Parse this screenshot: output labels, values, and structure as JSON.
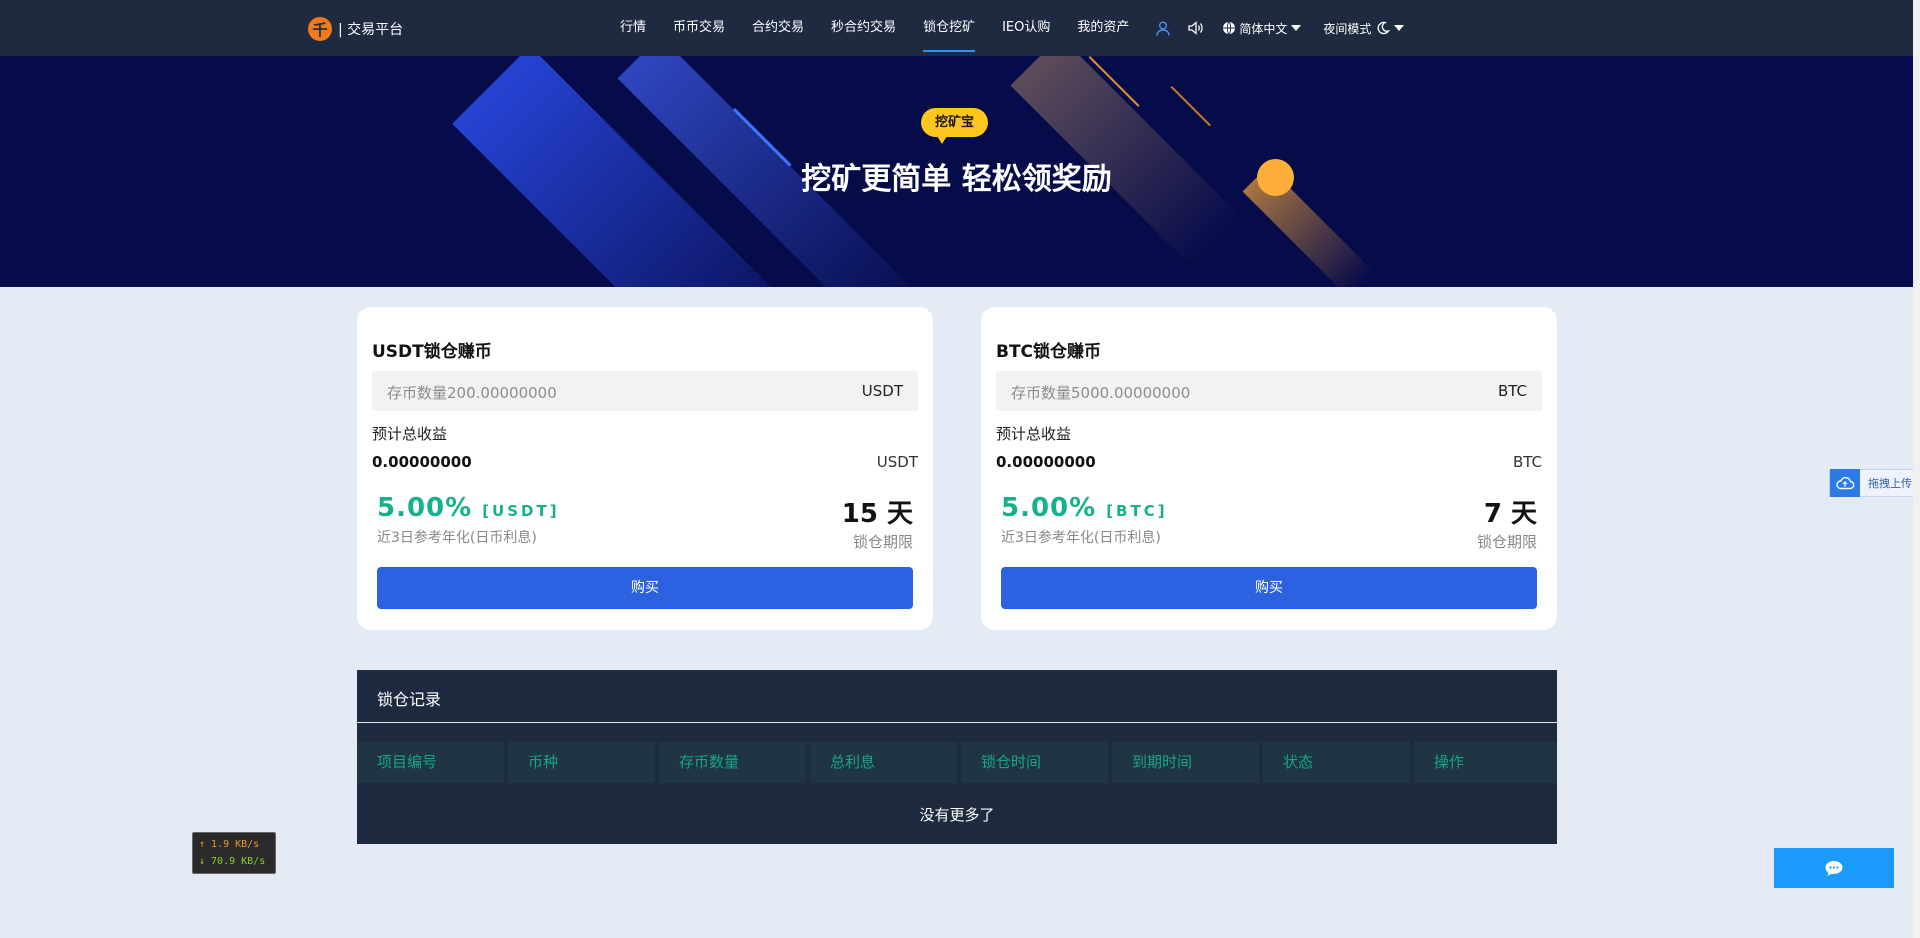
{
  "header": {
    "logo_glyph": "千",
    "logo_text": "| 交易平台",
    "nav": [
      "行情",
      "币币交易",
      "合约交易",
      "秒合约交易",
      "锁仓挖矿",
      "IEO认购",
      "我的资产"
    ],
    "active_nav": "锁仓挖矿",
    "language": "简体中文",
    "night_mode": "夜间模式"
  },
  "banner": {
    "badge": "挖矿宝",
    "title": "挖矿更简单 轻松领奖励"
  },
  "cards": [
    {
      "title": "USDT锁仓赚币",
      "input_placeholder": "存币数量200.00000000",
      "input_unit": "USDT",
      "estimate_label": "预计总收益",
      "estimate_value": "0.00000000",
      "estimate_unit": "USDT",
      "rate": "5.00%",
      "rate_coin": "[USDT]",
      "rate_label": "近3日参考年化(日币利息)",
      "days": "15 天",
      "days_label": "锁仓期限",
      "buy_label": "购买"
    },
    {
      "title": "BTC锁仓赚币",
      "input_placeholder": "存币数量5000.00000000",
      "input_unit": "BTC",
      "estimate_label": "预计总收益",
      "estimate_value": "0.00000000",
      "estimate_unit": "BTC",
      "rate": "5.00%",
      "rate_coin": "[BTC]",
      "rate_label": "近3日参考年化(日币利息)",
      "days": "7 天",
      "days_label": "锁仓期限",
      "buy_label": "购买"
    }
  ],
  "records": {
    "title": "锁仓记录",
    "columns": [
      "项目编号",
      "币种",
      "存币数量",
      "总利息",
      "锁仓时间",
      "到期时间",
      "状态",
      "操作"
    ],
    "empty_text": "没有更多了"
  },
  "speed_widget": {
    "up": "↑ 1.9 KB/s",
    "down": "↓ 70.9 KB/s"
  },
  "upload_widget": {
    "label": "拖拽上传"
  },
  "colors": {
    "nav_bg": "#1d2a3f",
    "banner_bg": "#060b4a",
    "accent_green": "#17b08d",
    "button_blue": "#2c62e1",
    "badge_yellow": "#ffc71d"
  }
}
